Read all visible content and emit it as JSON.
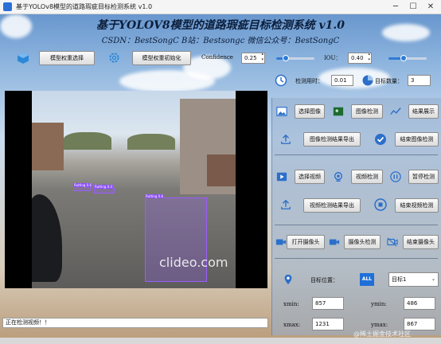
{
  "window": {
    "title": "基于YOLOv8模型的道路瑕疵目标检测系统 v1.0"
  },
  "header": {
    "title": "基于YOLOV8模型的道路瑕疵目标检测系统 v1.0",
    "subtitle": "CSDN：BestSongC   B站：Bestsongc   微信公众号：BestSongC"
  },
  "model": {
    "select_label": "模型权重选择",
    "init_label": "模型权重初始化",
    "confidence_label": "Confidence",
    "confidence_value": "0.25",
    "confidence_level": 0.25,
    "iou_label": "IOU：",
    "iou_value": "0.40",
    "iou_level": 0.4
  },
  "stats": {
    "time_label": "检测用时：",
    "time_value": "0.01",
    "count_label": "目标数量：",
    "count_value": "3"
  },
  "image_section": {
    "select_label": "选择图像",
    "detect_label": "图像检测",
    "show_label": "结果展示",
    "export_label": "图像检测结果导出",
    "end_label": "结束图像检测"
  },
  "video_section": {
    "select_label": "选择视频",
    "detect_label": "视频检测",
    "pause_label": "暂停检测",
    "export_label": "视频检测结果导出",
    "end_label": "结束视频检测"
  },
  "camera_section": {
    "open_label": "打开摄像头",
    "detect_label": "摄像头检测",
    "end_label": "结束摄像头"
  },
  "target": {
    "position_label": "目标位置：",
    "all_badge": "ALL",
    "select_value": "目标1",
    "xmin_label": "xmin:",
    "xmin_value": "857",
    "ymin_label": "ymin:",
    "ymin_value": "486",
    "xmax_label": "xmax:",
    "xmax_value": "1231",
    "ymax_label": "ymax:",
    "ymax_value": "867"
  },
  "video": {
    "watermark": "clideo.com",
    "detections": [
      "Rutting 0.6",
      "Rutting 0.4",
      "Rutting 0.6"
    ]
  },
  "status": {
    "text": "正在检测视频！！"
  },
  "footer": {
    "watermark": "@稀土掘金技术社区"
  }
}
